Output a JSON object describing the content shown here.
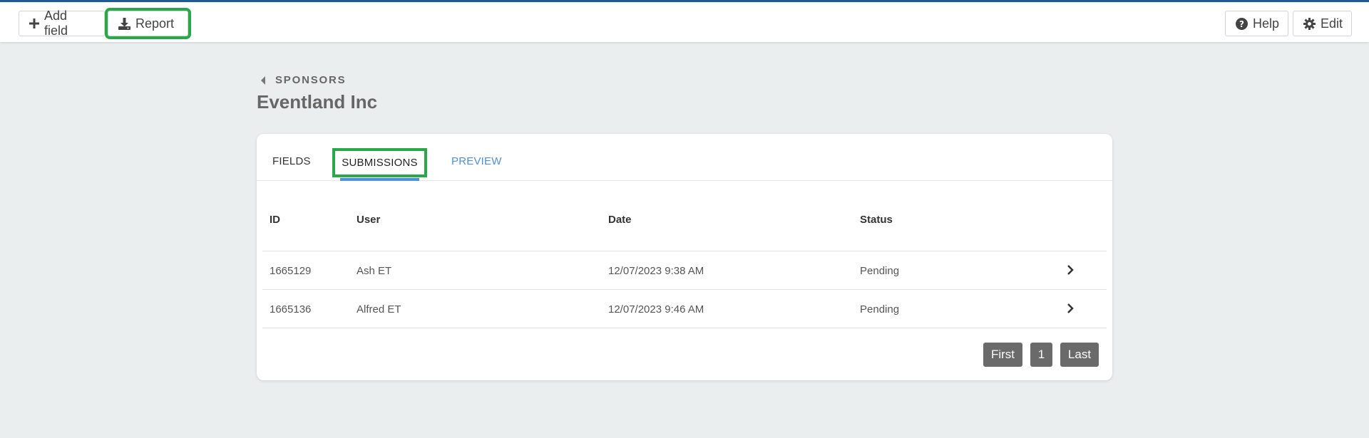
{
  "toolbar": {
    "add_field_label": "Add field",
    "report_label": "Report",
    "help_label": "Help",
    "edit_label": "Edit"
  },
  "breadcrumb": {
    "back_label": "SPONSORS"
  },
  "page": {
    "title": "Eventland Inc"
  },
  "tabs": [
    {
      "label": "FIELDS"
    },
    {
      "label": "SUBMISSIONS"
    },
    {
      "label": "PREVIEW"
    }
  ],
  "table": {
    "headers": {
      "id": "ID",
      "user": "User",
      "date": "Date",
      "status": "Status"
    },
    "rows": [
      {
        "id": "1665129",
        "user": "Ash ET",
        "date": "12/07/2023 9:38 AM",
        "status": "Pending"
      },
      {
        "id": "1665136",
        "user": "Alfred ET",
        "date": "12/07/2023 9:46 AM",
        "status": "Pending"
      }
    ]
  },
  "pagination": {
    "first": "First",
    "page": "1",
    "last": "Last"
  },
  "colors": {
    "accent_blue": "#4f8fd6",
    "highlight_green": "#29a84a",
    "topbar_border": "#1f5a96",
    "pager_bg": "#6a6a6a"
  },
  "icons": [
    "plus-icon",
    "download-icon",
    "question-circle-icon",
    "gear-icon",
    "caret-left-icon",
    "chevron-right-icon"
  ]
}
